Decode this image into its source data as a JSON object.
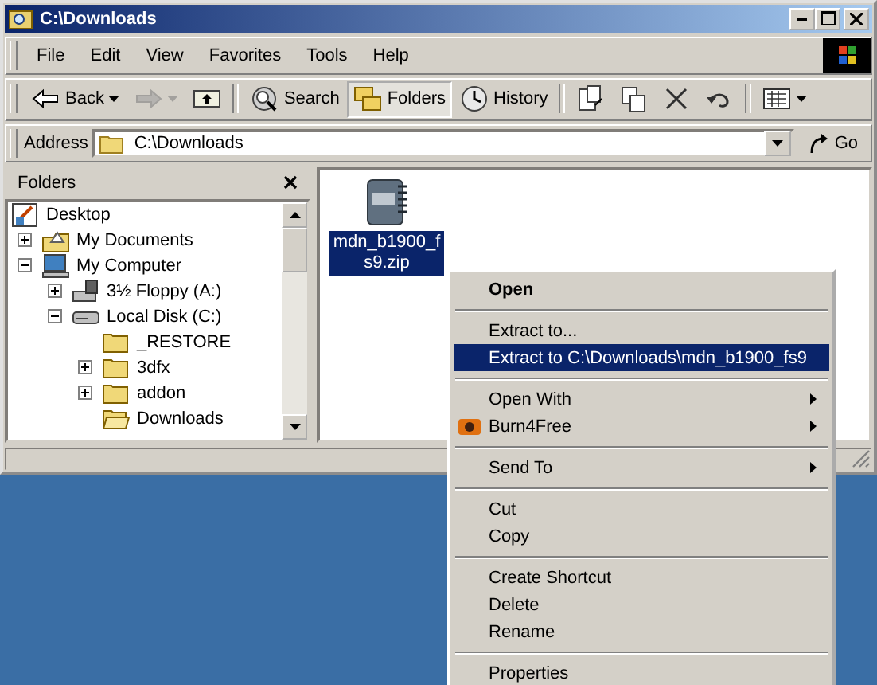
{
  "window": {
    "title": "C:\\Downloads"
  },
  "menu_bar": [
    {
      "label": "File"
    },
    {
      "label": "Edit"
    },
    {
      "label": "View"
    },
    {
      "label": "Favorites"
    },
    {
      "label": "Tools"
    },
    {
      "label": "Help"
    }
  ],
  "toolbar": [
    {
      "kind": "back",
      "label": "Back",
      "selected": false,
      "disabled": false
    },
    {
      "kind": "forward",
      "selected": false,
      "disabled": true
    },
    {
      "kind": "up",
      "selected": false,
      "disabled": false
    },
    {
      "kind": "search",
      "label": "Search",
      "selected": false,
      "disabled": false
    },
    {
      "kind": "folders",
      "label": "Folders",
      "selected": true,
      "disabled": false
    },
    {
      "kind": "history",
      "label": "History",
      "selected": false,
      "disabled": false
    },
    {
      "kind": "move",
      "selected": false,
      "disabled": false
    },
    {
      "kind": "copy",
      "selected": false,
      "disabled": false
    },
    {
      "kind": "delete",
      "selected": false,
      "disabled": false
    },
    {
      "kind": "undo",
      "selected": false,
      "disabled": false
    },
    {
      "kind": "views",
      "selected": false,
      "disabled": false
    }
  ],
  "address_bar": {
    "label": "Address",
    "value": "C:\\Downloads",
    "go": "Go"
  },
  "folders_pane": {
    "title": "Folders",
    "tree": [
      {
        "label": "Desktop",
        "kind": "desktop",
        "children": [
          {
            "label": "My Documents",
            "kind": "documents",
            "expandable": true,
            "expanded": false
          },
          {
            "label": "My Computer",
            "kind": "computer",
            "expandable": true,
            "expanded": true,
            "children": [
              {
                "label": "3½ Floppy (A:)",
                "kind": "floppy",
                "expandable": true,
                "expanded": false
              },
              {
                "label": "Local Disk (C:)",
                "kind": "disk",
                "expandable": true,
                "expanded": true,
                "children": [
                  {
                    "label": "_RESTORE",
                    "kind": "folder",
                    "expandable": false,
                    "expanded": false
                  },
                  {
                    "label": "3dfx",
                    "kind": "folder",
                    "expandable": true,
                    "expanded": false
                  },
                  {
                    "label": "addon",
                    "kind": "folder",
                    "expandable": true,
                    "expanded": false
                  },
                  {
                    "label": "Downloads",
                    "kind": "open_folder",
                    "expandable": false,
                    "expanded": false
                  }
                ]
              }
            ]
          }
        ]
      }
    ]
  },
  "files": [
    {
      "name": "mdn_b1900_fs9.zip",
      "selected": true
    }
  ],
  "context_menu": [
    {
      "kind": "item",
      "label": "Open",
      "bold": true,
      "selected": false,
      "submenu": false
    },
    {
      "kind": "separator"
    },
    {
      "kind": "item",
      "label": "Extract to...",
      "bold": false,
      "selected": false,
      "submenu": false
    },
    {
      "kind": "item",
      "label": "Extract to C:\\Downloads\\mdn_b1900_fs9",
      "bold": false,
      "selected": true,
      "submenu": false
    },
    {
      "kind": "separator"
    },
    {
      "kind": "item",
      "label": "Open With",
      "bold": false,
      "selected": false,
      "submenu": true
    },
    {
      "kind": "app_item",
      "label": "Burn4Free",
      "bold": false,
      "selected": false,
      "submenu": true
    },
    {
      "kind": "separator"
    },
    {
      "kind": "item",
      "label": "Send To",
      "bold": false,
      "selected": false,
      "submenu": true
    },
    {
      "kind": "separator"
    },
    {
      "kind": "item",
      "label": "Cut",
      "bold": false,
      "selected": false,
      "submenu": false
    },
    {
      "kind": "item",
      "label": "Copy",
      "bold": false,
      "selected": false,
      "submenu": false
    },
    {
      "kind": "separator"
    },
    {
      "kind": "item",
      "label": "Create Shortcut",
      "bold": false,
      "selected": false,
      "submenu": false
    },
    {
      "kind": "item",
      "label": "Delete",
      "bold": false,
      "selected": false,
      "submenu": false
    },
    {
      "kind": "item",
      "label": "Rename",
      "bold": false,
      "selected": false,
      "submenu": false
    },
    {
      "kind": "separator"
    },
    {
      "kind": "item",
      "label": "Properties",
      "bold": false,
      "selected": false,
      "submenu": false
    }
  ]
}
